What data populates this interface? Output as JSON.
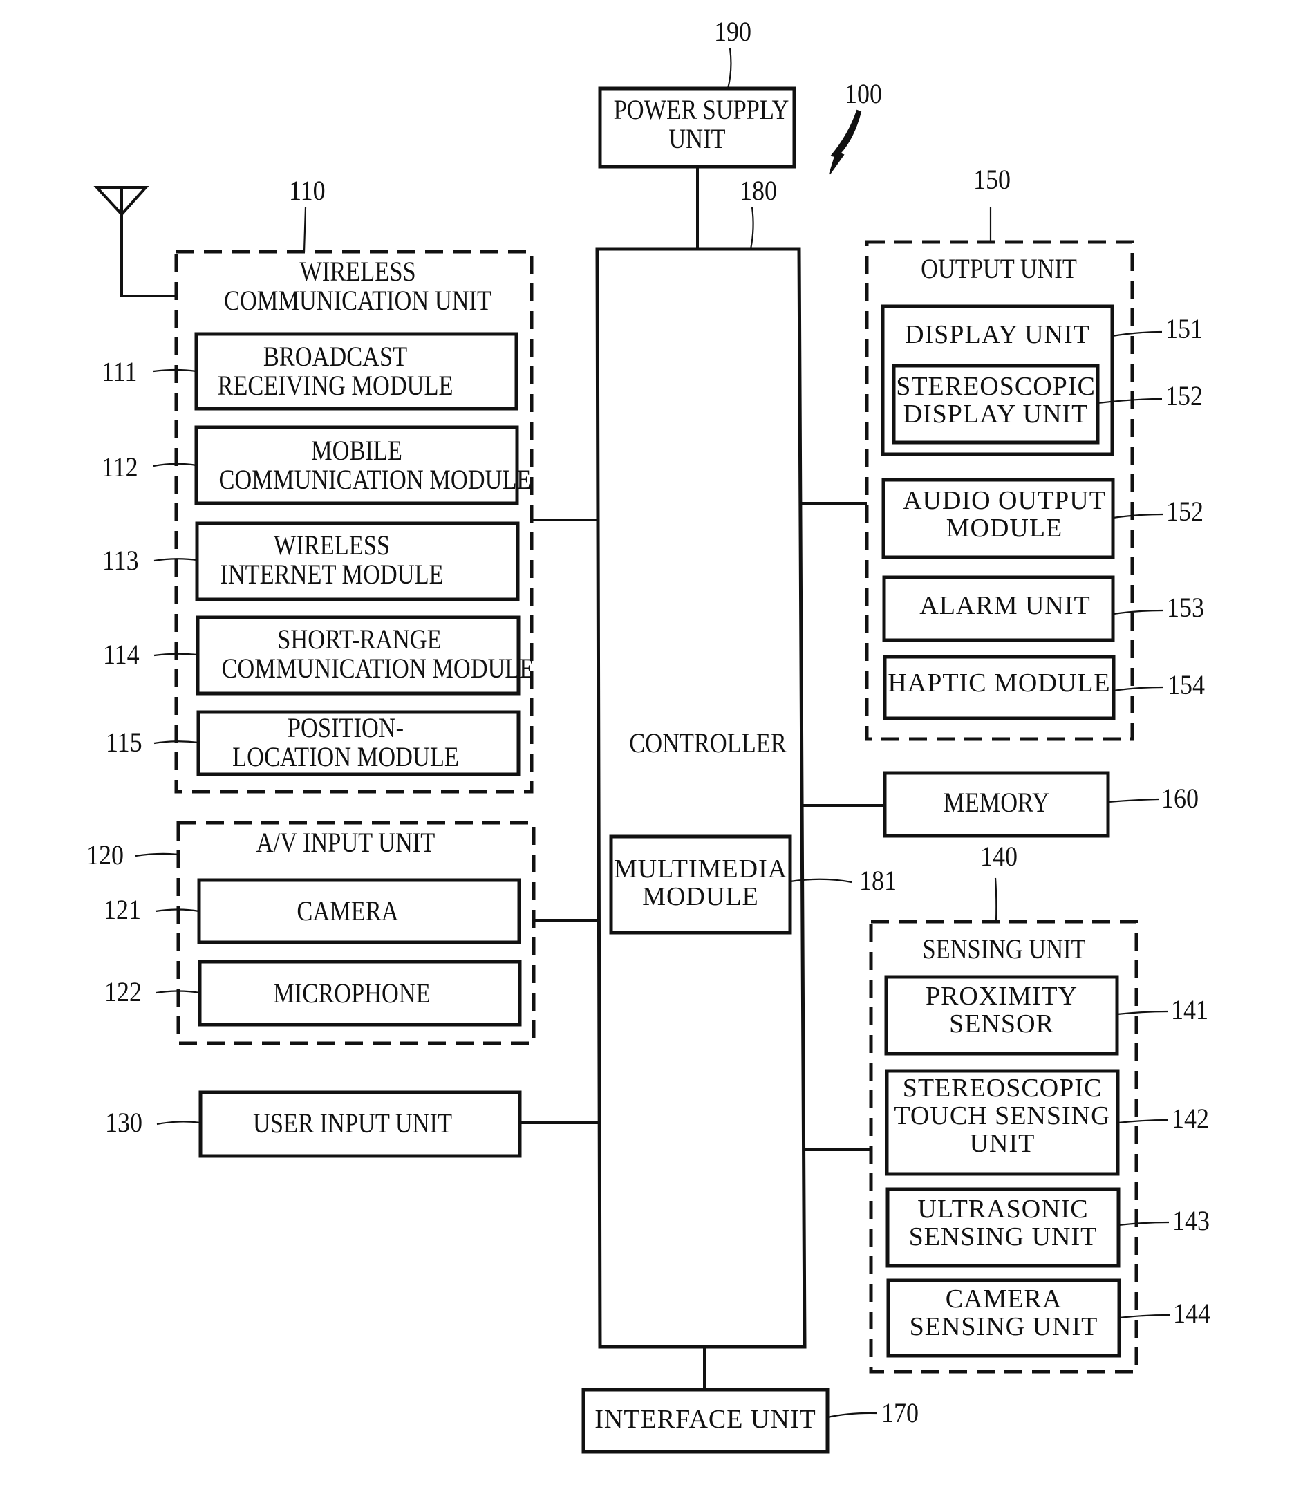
{
  "figure_ref": "100",
  "blocks": {
    "power_supply": {
      "ref": "190",
      "label": "POWER SUPPLY\nUNIT"
    },
    "controller": {
      "ref": "180",
      "label": "CONTROLLER"
    },
    "multimedia": {
      "ref": "181",
      "label": "MULTIMEDIA\nMODULE"
    },
    "interface": {
      "ref": "170",
      "label": "INTERFACE UNIT"
    },
    "wireless_comm": {
      "ref": "110",
      "label": "WIRELESS\nCOMMUNICATION UNIT",
      "modules": [
        {
          "ref": "111",
          "label": "BROADCAST\nRECEIVING MODULE"
        },
        {
          "ref": "112",
          "label": "MOBILE\nCOMMUNICATION MODULE"
        },
        {
          "ref": "113",
          "label": "WIRELESS\nINTERNET MODULE"
        },
        {
          "ref": "114",
          "label": "SHORT-RANGE\nCOMMUNICATION MODULE"
        },
        {
          "ref": "115",
          "label": "POSITION-\nLOCATION MODULE"
        }
      ]
    },
    "av_input": {
      "ref": "120",
      "label": "A/V INPUT UNIT",
      "modules": [
        {
          "ref": "121",
          "label": "CAMERA"
        },
        {
          "ref": "122",
          "label": "MICROPHONE"
        }
      ]
    },
    "user_input": {
      "ref": "130",
      "label": "USER INPUT UNIT"
    },
    "output": {
      "ref": "150",
      "label": "OUTPUT UNIT",
      "display": {
        "ref": "151",
        "label": "DISPLAY UNIT"
      },
      "stereo_display": {
        "ref": "152",
        "label": "STEREOSCOPIC\nDISPLAY UNIT"
      },
      "modules": [
        {
          "ref": "152",
          "label": "AUDIO OUTPUT\nMODULE"
        },
        {
          "ref": "153",
          "label": "ALARM UNIT"
        },
        {
          "ref": "154",
          "label": "HAPTIC MODULE"
        }
      ]
    },
    "memory": {
      "ref": "160",
      "label": "MEMORY"
    },
    "sensing": {
      "ref": "140",
      "label": "SENSING UNIT",
      "modules": [
        {
          "ref": "141",
          "label": "PROXIMITY\nSENSOR"
        },
        {
          "ref": "142",
          "label": "STEREOSCOPIC\nTOUCH SENSING\nUNIT"
        },
        {
          "ref": "143",
          "label": "ULTRASONIC\nSENSING UNIT"
        },
        {
          "ref": "144",
          "label": "CAMERA\nSENSING UNIT"
        }
      ]
    }
  }
}
